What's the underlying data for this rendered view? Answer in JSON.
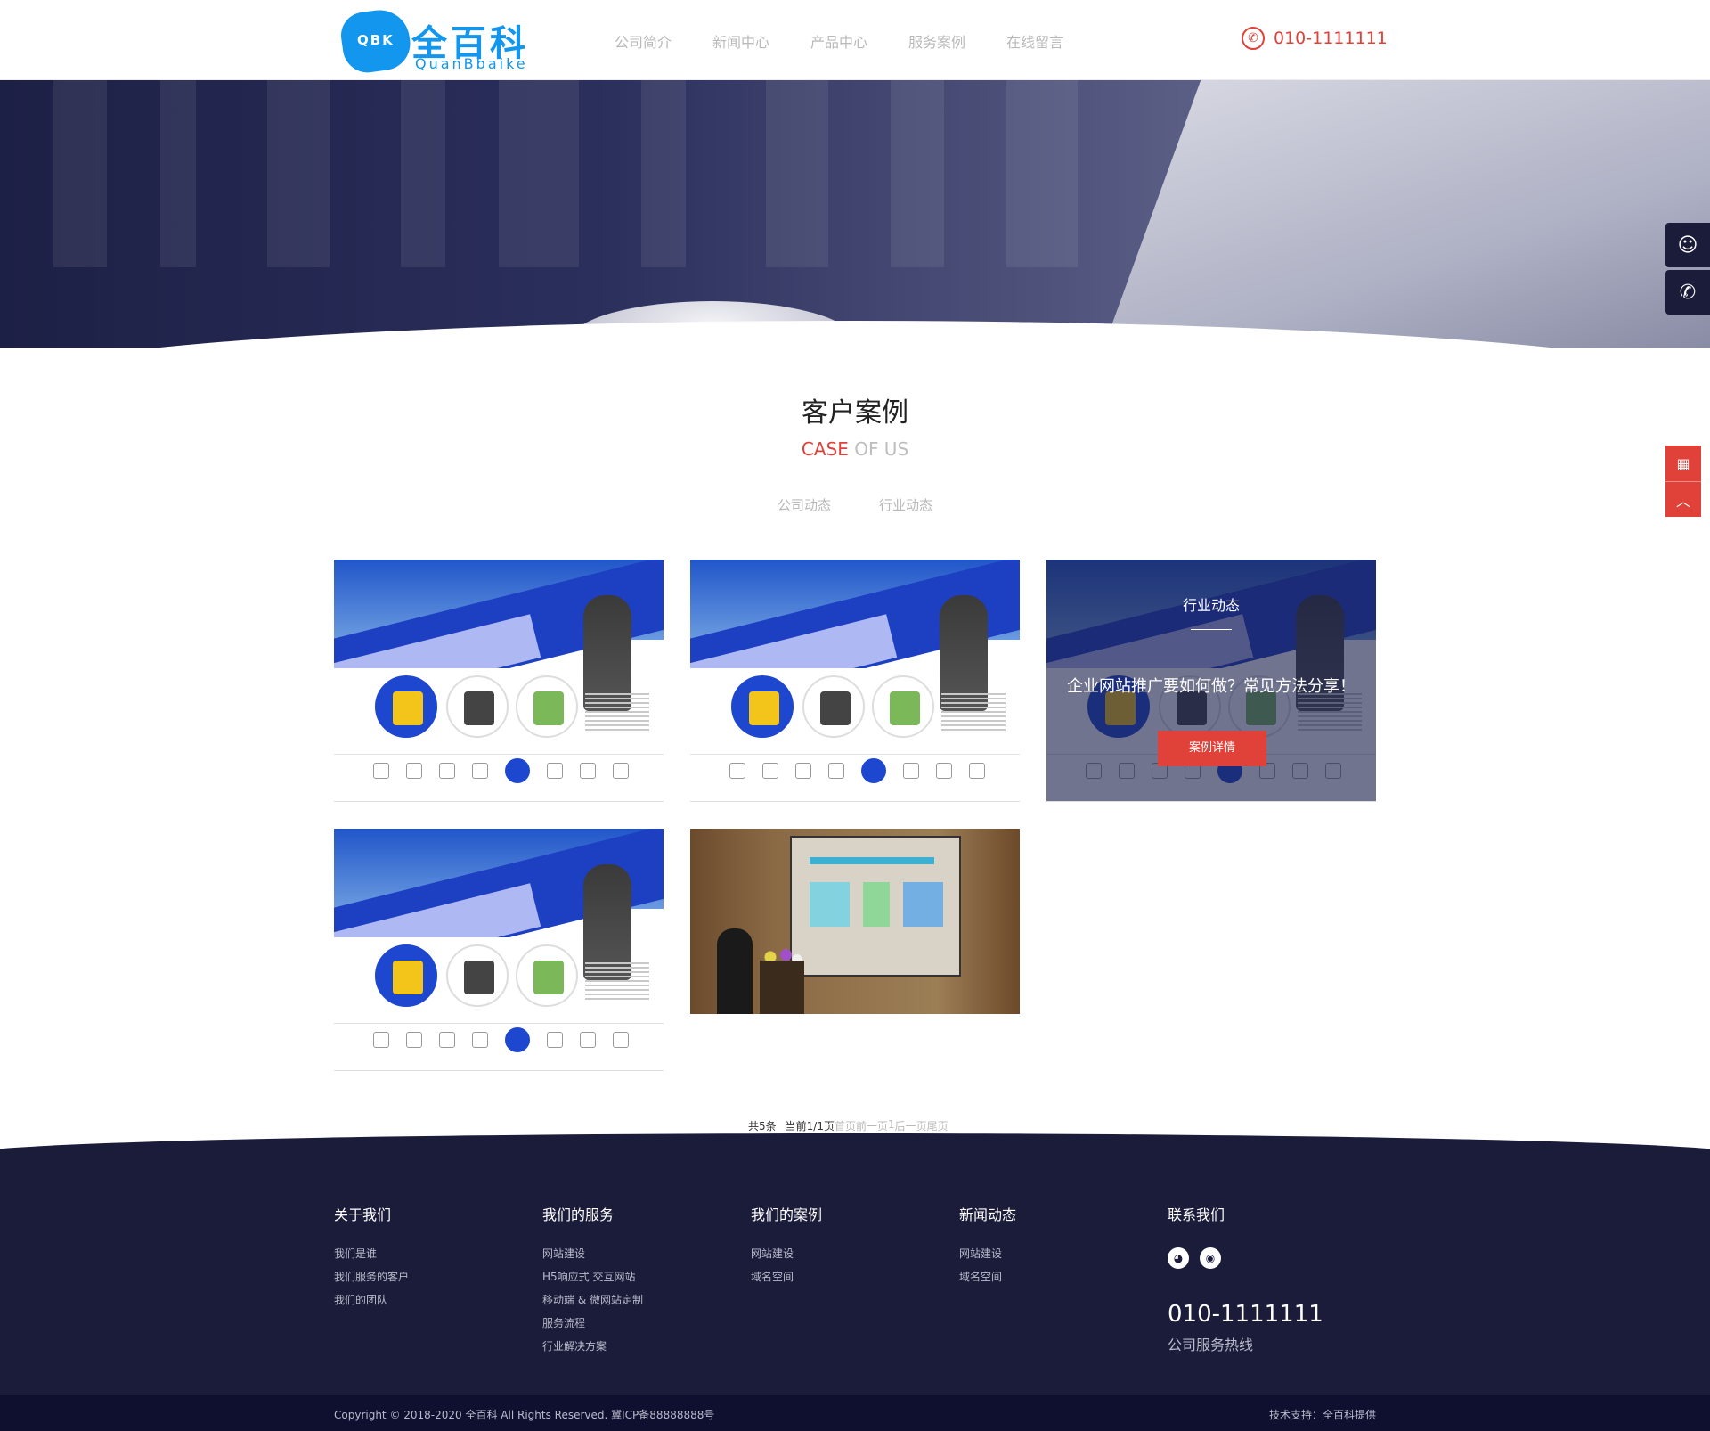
{
  "header": {
    "logo_badge": "QBK",
    "logo_cn": "全百科",
    "logo_en": "QuanBbaike",
    "nav": [
      "公司简介",
      "新闻中心",
      "产品中心",
      "服务案例",
      "在线留言"
    ],
    "phone": "010-1111111"
  },
  "section": {
    "title": "客户案例",
    "sub_red": "CASE",
    "sub_grey": " OF US",
    "tabs": [
      "公司动态",
      "行业动态"
    ]
  },
  "cards": [
    {
      "type": "mockup"
    },
    {
      "type": "mockup"
    },
    {
      "type": "mockup",
      "hover": true,
      "category": "行业动态",
      "title": "企业网站推广要如何做？常见方法分享！",
      "button": "案例详情"
    },
    {
      "type": "mockup"
    },
    {
      "type": "photo"
    }
  ],
  "pagination": {
    "total": "共5条",
    "current": "当前1/1页",
    "first": "首页",
    "prev": "前一页",
    "page": "1",
    "next": "后一页",
    "last": "尾页"
  },
  "footer": {
    "columns": [
      {
        "title": "关于我们",
        "items": [
          "我们是谁",
          "我们服务的客户",
          "我们的团队"
        ]
      },
      {
        "title": "我们的服务",
        "items": [
          "网站建设",
          "H5响应式 交互网站",
          "移动端 & 微网站定制",
          "服务流程",
          "行业解决方案"
        ]
      },
      {
        "title": "我们的案例",
        "items": [
          "网站建设",
          "域名空间"
        ]
      },
      {
        "title": "新闻动态",
        "items": [
          "网站建设",
          "域名空间"
        ]
      }
    ],
    "contact_title": "联系我们",
    "phone": "010-1111111",
    "phone_label": "公司服务热线",
    "copyright": "Copyright © 2018-2020 全百科 All Rights Reserved.    冀ICP备88888888号",
    "support": "技术支持：全百科提供"
  },
  "colors": {
    "accent": "#e0423a",
    "brand": "#1296ee",
    "footer": "#1b1c3a"
  },
  "icons": [
    "phone-icon",
    "qq-icon",
    "phone-float-icon",
    "qrcode-icon",
    "back-to-top-icon",
    "wechat-icon",
    "weibo-icon"
  ]
}
